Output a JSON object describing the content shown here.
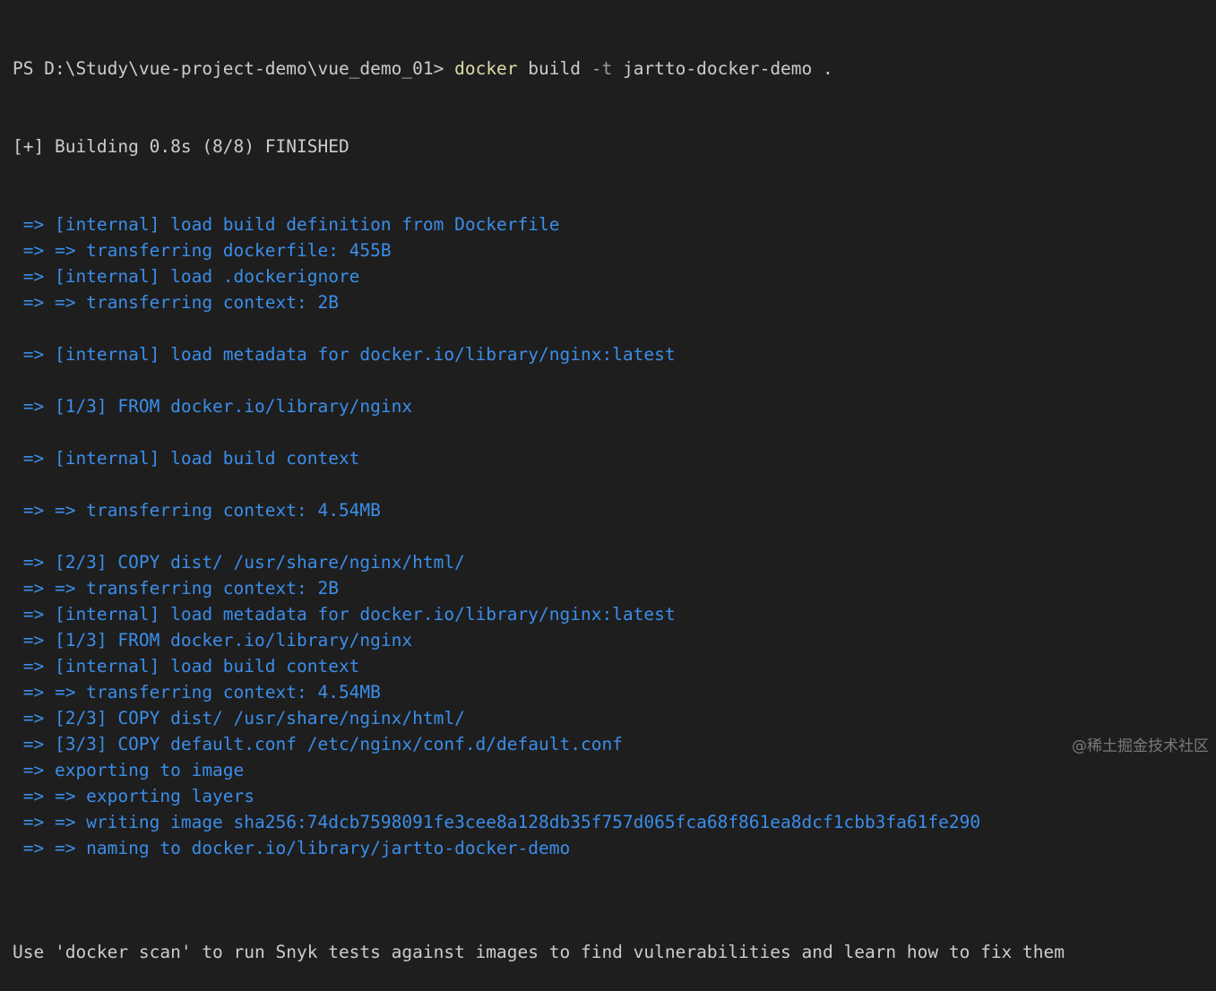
{
  "prompt": {
    "prefix": "PS D:\\Study\\vue-project-demo\\vue_demo_01> ",
    "command": "docker",
    "arg_build": " build ",
    "flag": "-t",
    "rest": " jartto-docker-demo ."
  },
  "status_line": "[+] Building 0.8s (8/8) FINISHED",
  "build_steps": [
    " => [internal] load build definition from Dockerfile",
    " => => transferring dockerfile: 455B",
    " => [internal] load .dockerignore",
    " => => transferring context: 2B",
    "",
    " => [internal] load metadata for docker.io/library/nginx:latest",
    "",
    " => [1/3] FROM docker.io/library/nginx",
    "",
    " => [internal] load build context",
    "",
    " => => transferring context: 4.54MB",
    "",
    " => [2/3] COPY dist/ /usr/share/nginx/html/",
    " => => transferring context: 2B",
    " => [internal] load metadata for docker.io/library/nginx:latest",
    " => [1/3] FROM docker.io/library/nginx",
    " => [internal] load build context",
    " => => transferring context: 4.54MB",
    " => [2/3] COPY dist/ /usr/share/nginx/html/",
    " => [3/3] COPY default.conf /etc/nginx/conf.d/default.conf",
    " => exporting to image",
    " => => exporting layers",
    " => => writing image sha256:74dcb7598091fe3cee8a128db35f757d065fca68f861ea8dcf1cbb3fa61fe290",
    " => => naming to docker.io/library/jartto-docker-demo",
    ""
  ],
  "footer_line": "Use 'docker scan' to run Snyk tests against images to find vulnerabilities and learn how to fix them",
  "watermark": "@稀土掘金技术社区",
  "colors": {
    "background": "#1e1e1e",
    "text": "#cccccc",
    "command": "#dcdcaa",
    "flag": "#9d9d9d",
    "step": "#3b8eea"
  }
}
